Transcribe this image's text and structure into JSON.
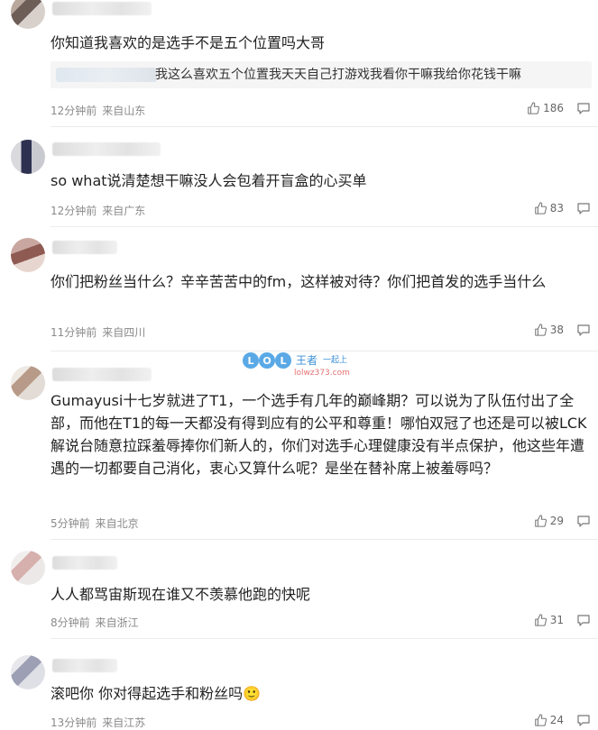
{
  "comments": [
    {
      "text": "你知道我喜欢的是选手不是五个位置吗大哥",
      "quote": "我这么喜欢五个位置我天天自己打游戏我看你干嘛我给你花钱干嘛",
      "time": "12分钟前",
      "location": "来自山东",
      "likes": "186"
    },
    {
      "text": "so what说清楚想干嘛没人会包着开盲盒的心买单",
      "time": "12分钟前",
      "location": "来自广东",
      "likes": "83"
    },
    {
      "text": "你们把粉丝当什么？辛辛苦苦中的fm，这样被对待？你们把首发的选手当什么",
      "time": "11分钟前",
      "location": "来自四川",
      "likes": "38"
    },
    {
      "text": "Gumayusi十七岁就进了T1，一个选手有几年的巅峰期？可以说为了队伍付出了全部，而他在T1的每一天都没有得到应有的公平和尊重！哪怕双冠了也还是可以被LCK解说台随意拉踩羞辱捧你们新人的，你们对选手心理健康没有半点保护，他这些年遭遇的一切都要自己消化，衷心又算什么呢？是坐在替补席上被羞辱吗？",
      "time": "5分钟前",
      "location": "来自北京",
      "likes": "29"
    },
    {
      "text": "人人都骂宙斯现在谁又不羡慕他跑的快呢",
      "time": "8分钟前",
      "location": "来自浙江",
      "likes": "31"
    },
    {
      "text": "滚吧你 你对得起选手和粉丝吗",
      "emoji": "🙂",
      "time": "13分钟前",
      "location": "来自江苏",
      "likes": "24"
    }
  ],
  "watermark": {
    "brand": "LOL",
    "title": "王者",
    "slogan": "一起上",
    "site": "lolwz373.com"
  },
  "icons": {
    "like": "thumbs-up-icon",
    "reply": "comment-icon"
  }
}
